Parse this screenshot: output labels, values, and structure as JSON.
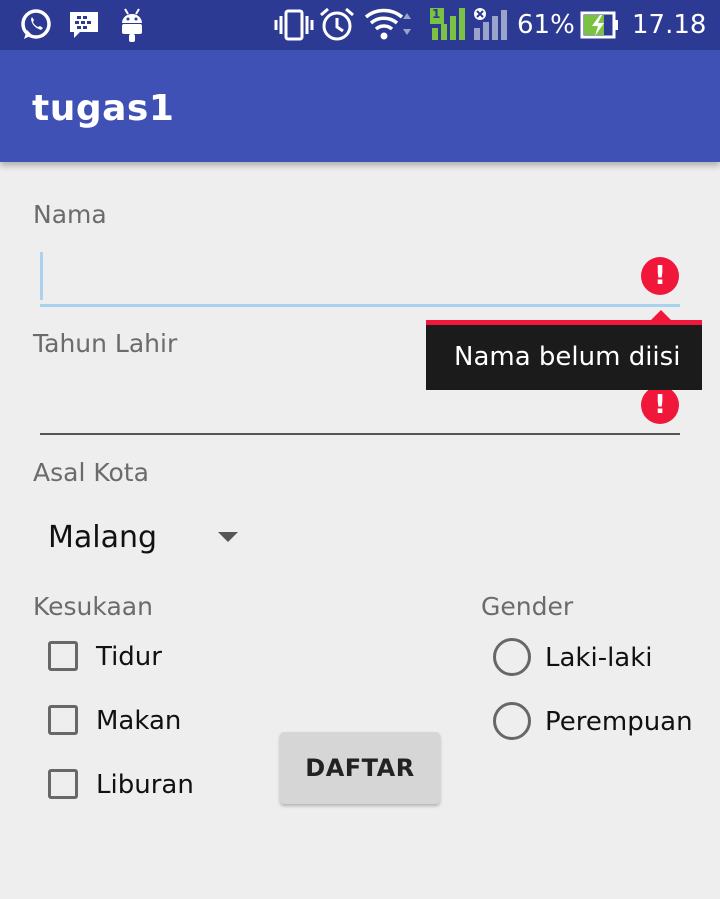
{
  "status_bar": {
    "battery_percent": "61%",
    "time": "17.18",
    "sim_badge": "1",
    "icons": [
      "whatsapp-icon",
      "bbm-icon",
      "android-icon",
      "vibrate-icon",
      "alarm-icon",
      "wifi-icon",
      "signal-icon",
      "no-signal-icon",
      "battery-charging-icon"
    ]
  },
  "app_bar": {
    "title": "tugas1"
  },
  "form": {
    "nama_label": "Nama",
    "nama_value": "",
    "tahun_lahir_label": "Tahun Lahir",
    "tahun_lahir_value": "",
    "error_tooltip": "Nama belum diisi",
    "asal_kota_label": "Asal Kota",
    "asal_kota_selected": "Malang",
    "kesukaan_label": "Kesukaan",
    "kesukaan_options": [
      "Tidur",
      "Makan",
      "Liburan"
    ],
    "gender_label": "Gender",
    "gender_options": [
      "Laki-laki",
      "Perempuan"
    ],
    "submit_label": "DAFTAR"
  },
  "colors": {
    "status_bar": "#2c3a93",
    "app_bar": "#3f51b5",
    "error": "#f0173a",
    "focus_line": "#a9d2ee"
  }
}
